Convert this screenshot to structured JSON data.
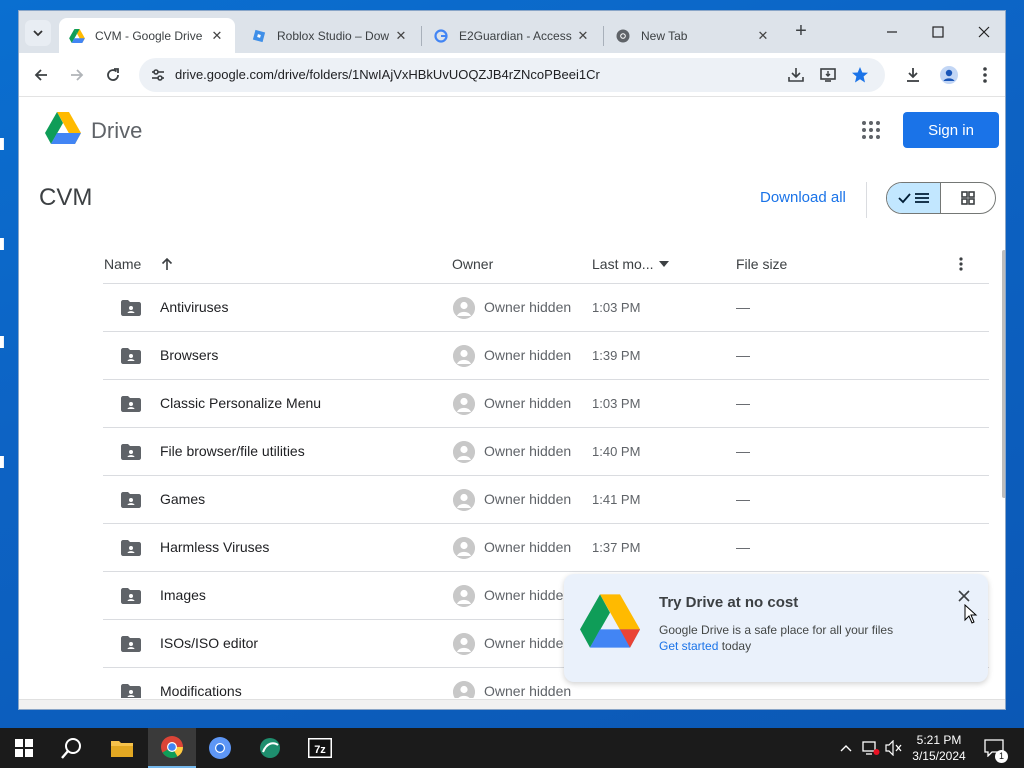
{
  "browser": {
    "tabs": [
      {
        "title": "CVM - Google Drive",
        "icon": "google-drive-icon",
        "active": true
      },
      {
        "title": "Roblox Studio – Dow",
        "icon": "roblox-studio-icon",
        "active": false
      },
      {
        "title": "E2Guardian - Access",
        "icon": "google-g-icon",
        "active": false
      },
      {
        "title": "New Tab",
        "icon": "chrome-icon",
        "active": false
      }
    ],
    "url": "drive.google.com/drive/folders/1NwIAjVxHBkUvUOQZJB4rZNcoPBeei1Cr"
  },
  "drive": {
    "brand": "Drive",
    "sign_in": "Sign in",
    "folder_title": "CVM",
    "download_all": "Download all",
    "columns": {
      "name": "Name",
      "owner": "Owner",
      "modified": "Last mo...",
      "size": "File size"
    },
    "rows": [
      {
        "name": "Antiviruses",
        "owner": "Owner hidden",
        "modified": "1:03 PM",
        "size": "—"
      },
      {
        "name": "Browsers",
        "owner": "Owner hidden",
        "modified": "1:39 PM",
        "size": "—"
      },
      {
        "name": "Classic Personalize Menu",
        "owner": "Owner hidden",
        "modified": "1:03 PM",
        "size": "—"
      },
      {
        "name": "File browser/file utilities",
        "owner": "Owner hidden",
        "modified": "1:40 PM",
        "size": "—"
      },
      {
        "name": "Games",
        "owner": "Owner hidden",
        "modified": "1:41 PM",
        "size": "—"
      },
      {
        "name": "Harmless Viruses",
        "owner": "Owner hidden",
        "modified": "1:37 PM",
        "size": "—"
      },
      {
        "name": "Images",
        "owner": "Owner hidden",
        "modified": "",
        "size": ""
      },
      {
        "name": "ISOs/ISO editor",
        "owner": "Owner hidden",
        "modified": "",
        "size": ""
      },
      {
        "name": "Modifications",
        "owner": "Owner hidden",
        "modified": "",
        "size": ""
      }
    ],
    "promo": {
      "title": "Try Drive at no cost",
      "text": "Google Drive is a safe place for all your files",
      "link": "Get started",
      "suffix": " today"
    }
  },
  "taskbar": {
    "apps": [
      "start-icon",
      "search-icon",
      "file-explorer-icon",
      "chrome-icon",
      "chromium-icon",
      "app-icon",
      "7zip-icon"
    ],
    "time": "5:21 PM",
    "date": "3/15/2024",
    "notification_count": "1"
  },
  "colors": {
    "accent": "#1a73e8",
    "toggle_on": "#c2e7ff",
    "promo_bg": "#eaf1fb",
    "tabstrip": "#dde3ea"
  }
}
